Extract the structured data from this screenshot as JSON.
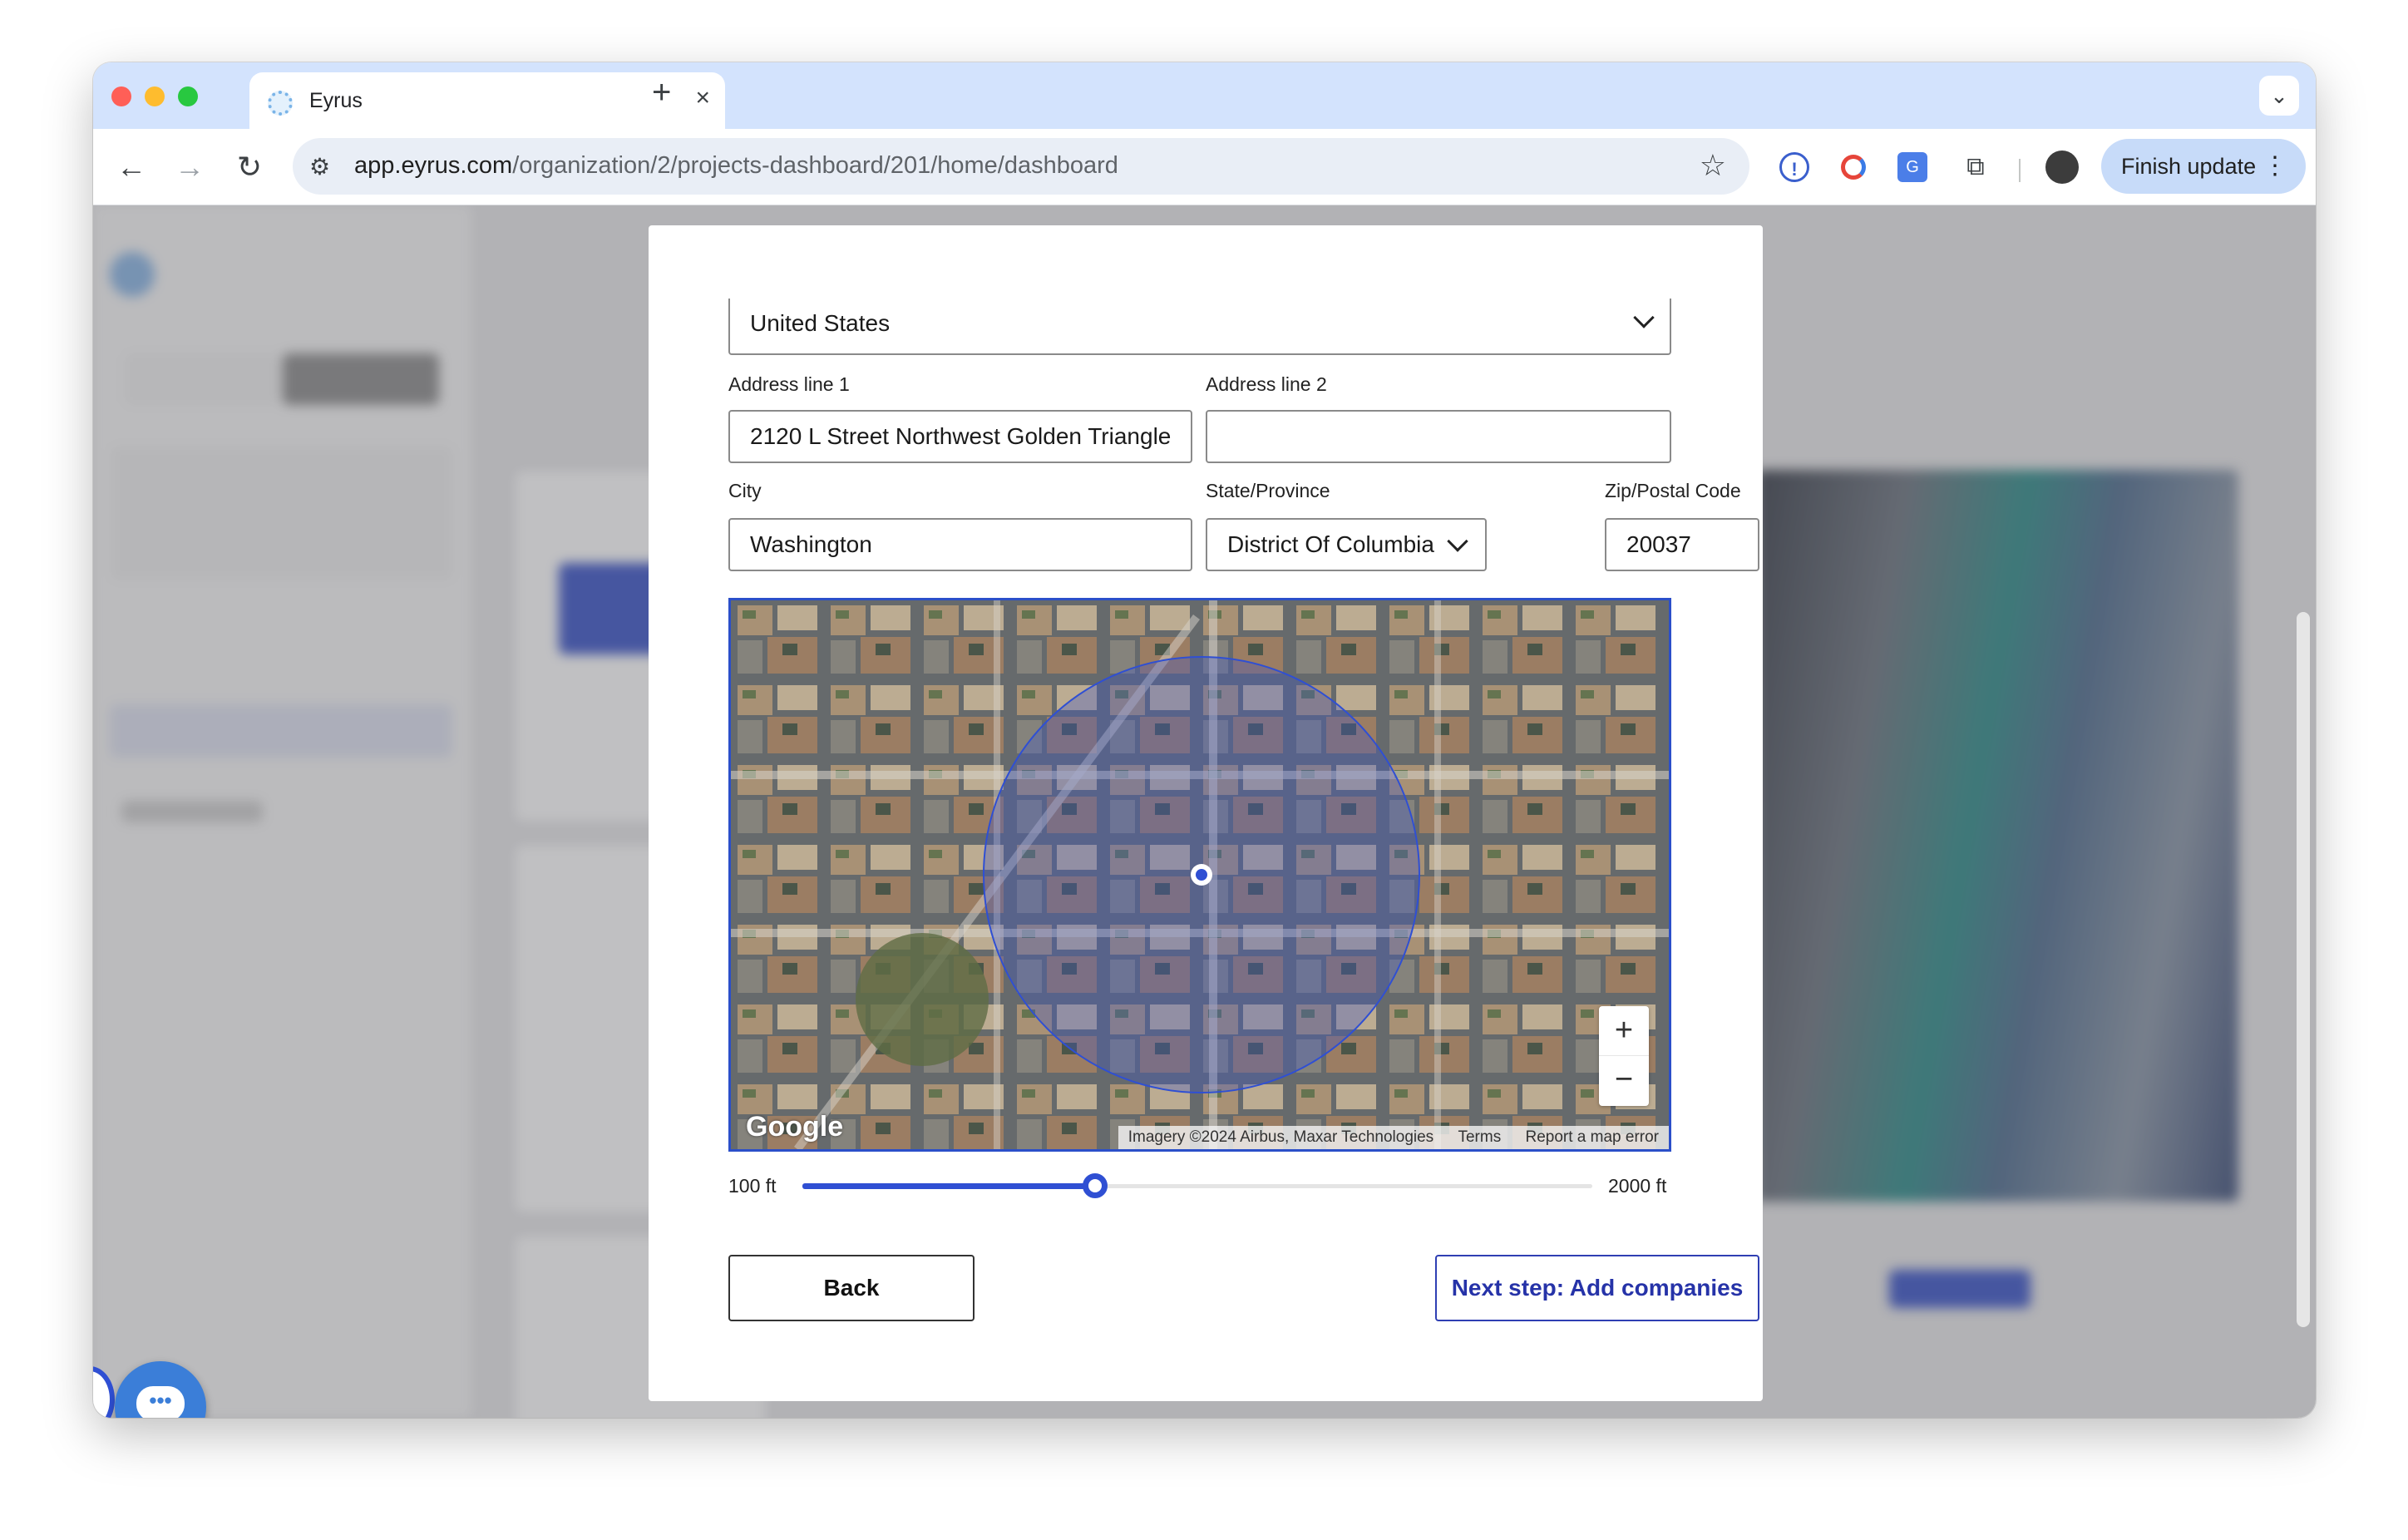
{
  "browser": {
    "tab_title": "Eyrus",
    "new_tab": "+",
    "tab_menu": "⌄",
    "url_host": "app.eyrus.com",
    "url_path": "/organization/2/projects-dashboard/201/home/dashboard",
    "finish_update": "Finish update",
    "menu_dots": "⋮",
    "back": "←",
    "forward": "→",
    "reload": "↻",
    "star": "☆"
  },
  "modal": {
    "country_value": "United States",
    "address1_label": "Address line 1",
    "address1_value": "2120  L Street Northwest Golden Triangle",
    "address2_label": "Address line 2",
    "address2_value": "",
    "city_label": "City",
    "city_value": "Washington",
    "state_label": "State/Province",
    "state_value": "District Of Columbia",
    "zip_label": "Zip/Postal Code",
    "zip_value": "20037",
    "map": {
      "zoom_in": "+",
      "zoom_out": "−",
      "logo": "Google",
      "attribution": "Imagery ©2024 Airbus, Maxar Technologies",
      "terms": "Terms",
      "report": "Report a map error"
    },
    "radius": {
      "min_label": "100 ft",
      "max_label": "2000 ft",
      "value_fraction": 0.37
    },
    "back_button": "Back",
    "next_button": "Next step: Add companies"
  },
  "colors": {
    "accent": "#2f4fd3",
    "chat_bubble": "#3b7ed8"
  }
}
